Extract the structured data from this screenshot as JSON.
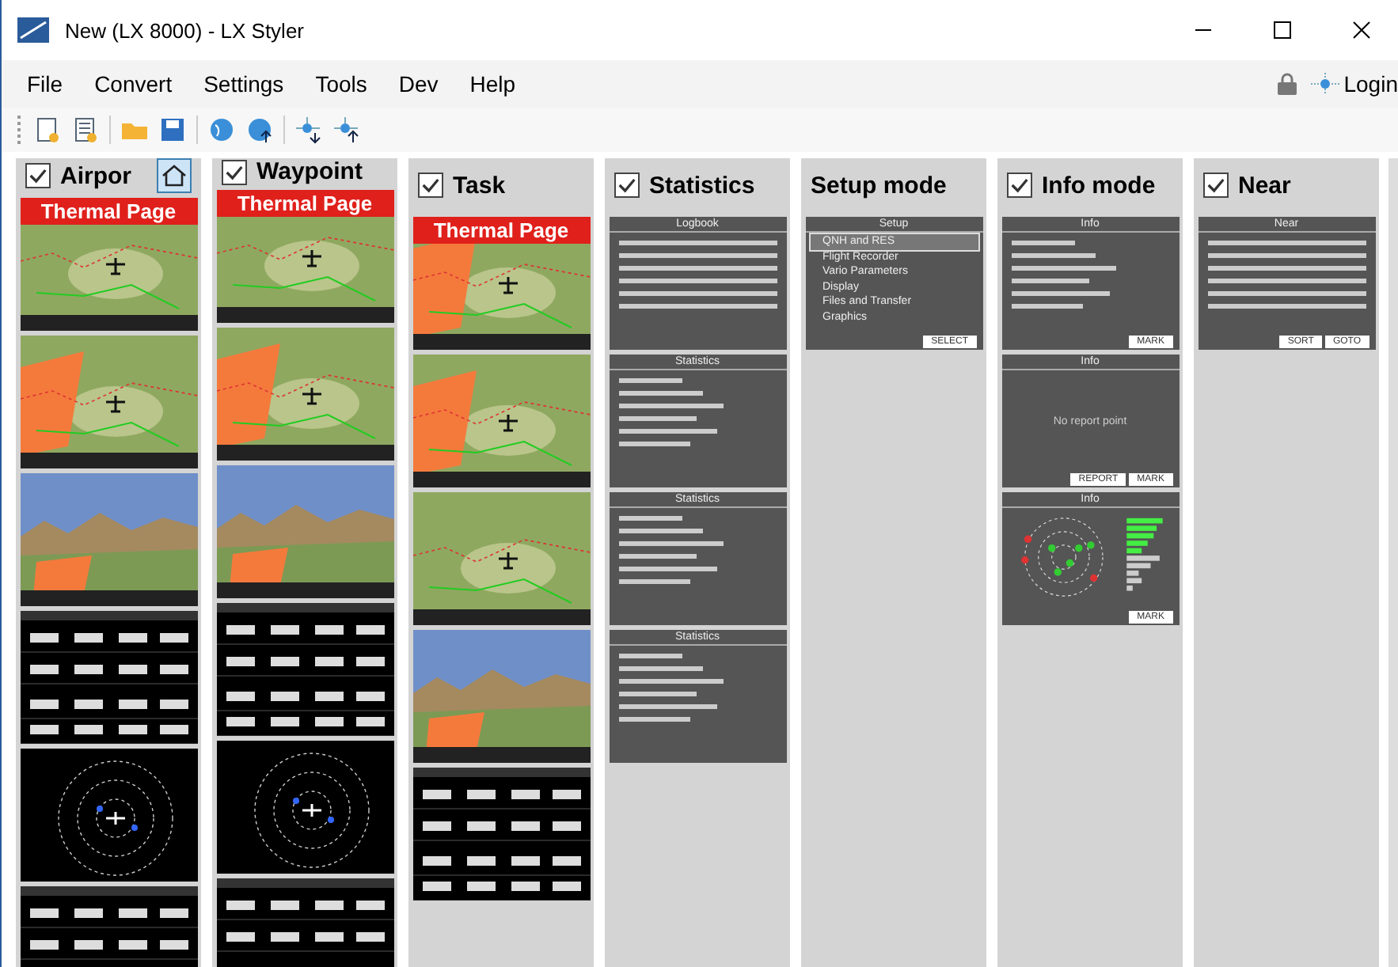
{
  "window": {
    "title": "New (LX 8000) - LX Styler"
  },
  "menu": [
    "File",
    "Convert",
    "Settings",
    "Tools",
    "Dev",
    "Help"
  ],
  "login": {
    "label": "Login"
  },
  "columns": [
    {
      "title": "Airpor",
      "checked": true,
      "home_button": true,
      "pages": [
        {
          "kind": "map",
          "banner": "Thermal Page"
        },
        {
          "kind": "airspace"
        },
        {
          "kind": "profile"
        },
        {
          "kind": "numeric"
        },
        {
          "kind": "radar"
        },
        {
          "kind": "numeric"
        }
      ]
    },
    {
      "title": "Waypoint",
      "checked": true,
      "pages": [
        {
          "kind": "map",
          "banner": "Thermal Page"
        },
        {
          "kind": "airspace"
        },
        {
          "kind": "profile"
        },
        {
          "kind": "numeric"
        },
        {
          "kind": "radar"
        },
        {
          "kind": "numeric"
        }
      ]
    },
    {
      "title": "Task",
      "checked": true,
      "pages": [
        {
          "kind": "airspace",
          "banner": "Thermal Page"
        },
        {
          "kind": "airspace"
        },
        {
          "kind": "map"
        },
        {
          "kind": "profile"
        },
        {
          "kind": "numeric"
        }
      ]
    },
    {
      "title": "Statistics",
      "checked": true,
      "pages": [
        {
          "kind": "table",
          "title": "Logbook"
        },
        {
          "kind": "text",
          "title": "Statistics"
        },
        {
          "kind": "text",
          "title": "Statistics"
        },
        {
          "kind": "text",
          "title": "Statistics"
        }
      ]
    },
    {
      "title": "Setup mode",
      "pages": [
        {
          "kind": "list",
          "title": "Setup",
          "items": [
            {
              "label": "QNH and RES",
              "selected": true
            },
            {
              "label": "Flight Recorder",
              "selected": false
            },
            {
              "label": "Vario Parameters",
              "selected": false
            },
            {
              "label": "Display",
              "selected": false
            },
            {
              "label": "Files and Transfer",
              "selected": false
            },
            {
              "label": "Graphics",
              "selected": false
            }
          ],
          "buttons": [
            "SELECT"
          ]
        }
      ]
    },
    {
      "title": "Info mode",
      "checked": true,
      "pages": [
        {
          "kind": "text",
          "title": "Info",
          "buttons": [
            "MARK"
          ]
        },
        {
          "kind": "text",
          "title": "Info",
          "note": "No report point",
          "buttons": [
            "REPORT",
            "MARK"
          ]
        },
        {
          "kind": "satellites",
          "title": "Info",
          "buttons": [
            "MARK"
          ]
        }
      ]
    },
    {
      "title": "Near",
      "checked": true,
      "pages": [
        {
          "kind": "table",
          "title": "Near",
          "buttons": [
            "SORT",
            "GOTO"
          ]
        }
      ]
    }
  ]
}
